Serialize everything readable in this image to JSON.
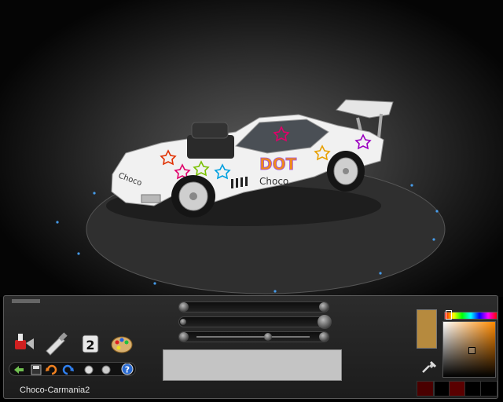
{
  "viewport": {
    "car_livery_texts": [
      "Choco",
      "Choco",
      "DOT"
    ]
  },
  "toolbar": {
    "tools": [
      {
        "name": "paint-spray-tool-icon"
      },
      {
        "name": "brush-tool-icon"
      },
      {
        "name": "layer-two-icon",
        "label": "2"
      },
      {
        "name": "palette-icon"
      }
    ],
    "small_tools": [
      {
        "name": "back-arrow-icon"
      },
      {
        "name": "save-icon"
      },
      {
        "name": "rotate-left-icon"
      },
      {
        "name": "rotate-right-icon"
      },
      {
        "name": "zoom-in-icon"
      },
      {
        "name": "zoom-out-icon"
      },
      {
        "name": "help-icon",
        "label": "?"
      }
    ]
  },
  "profile": {
    "name": "Choco-Carmania2"
  },
  "sliders": [
    {
      "name": "size-slider",
      "value": 1.0
    },
    {
      "name": "opacity-slider",
      "value": 1.0
    },
    {
      "name": "hardness-slider",
      "value": 0.5
    }
  ],
  "colors": {
    "current": "#b68a3e",
    "sv_hue": "#ff8a00",
    "recent": [
      "#4a0000",
      "#000000",
      "#5a0000",
      "#000000",
      "#000000"
    ]
  }
}
